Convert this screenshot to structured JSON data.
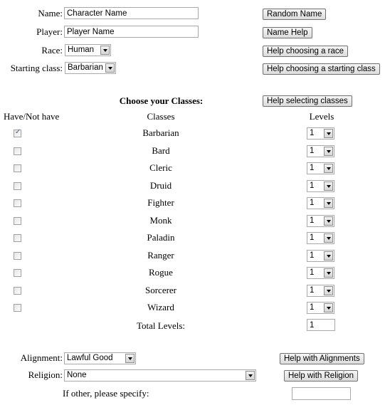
{
  "identity": {
    "name": {
      "label": "Name:",
      "value": "Character Name",
      "button": "Random Name"
    },
    "player": {
      "label": "Player:",
      "value": "Player Name",
      "button": "Name Help"
    },
    "race": {
      "label": "Race:",
      "value": "Human",
      "button": "Help choosing a race"
    },
    "starting_class": {
      "label": "Starting class:",
      "value": "Barbarian",
      "button": "Help choosing a starting class"
    }
  },
  "classes": {
    "heading": "Choose your Classes:",
    "help_button": "Help selecting classes",
    "col_have": "Have/Not have",
    "col_classes": "Classes",
    "col_levels": "Levels",
    "rows": [
      {
        "name": "Barbarian",
        "checked": true,
        "level": "1"
      },
      {
        "name": "Bard",
        "checked": false,
        "level": "1"
      },
      {
        "name": "Cleric",
        "checked": false,
        "level": "1"
      },
      {
        "name": "Druid",
        "checked": false,
        "level": "1"
      },
      {
        "name": "Fighter",
        "checked": false,
        "level": "1"
      },
      {
        "name": "Monk",
        "checked": false,
        "level": "1"
      },
      {
        "name": "Paladin",
        "checked": false,
        "level": "1"
      },
      {
        "name": "Ranger",
        "checked": false,
        "level": "1"
      },
      {
        "name": "Rogue",
        "checked": false,
        "level": "1"
      },
      {
        "name": "Sorcerer",
        "checked": false,
        "level": "1"
      },
      {
        "name": "Wizard",
        "checked": false,
        "level": "1"
      }
    ],
    "total_label": "Total Levels:",
    "total_value": "1"
  },
  "beliefs": {
    "alignment": {
      "label": "Alignment:",
      "value": "Lawful Good",
      "button": "Help with Alignments"
    },
    "religion": {
      "label": "Religion:",
      "value": "None",
      "button": "Help with Religion"
    },
    "other": {
      "label": "If other, please specify:",
      "value": ""
    }
  }
}
